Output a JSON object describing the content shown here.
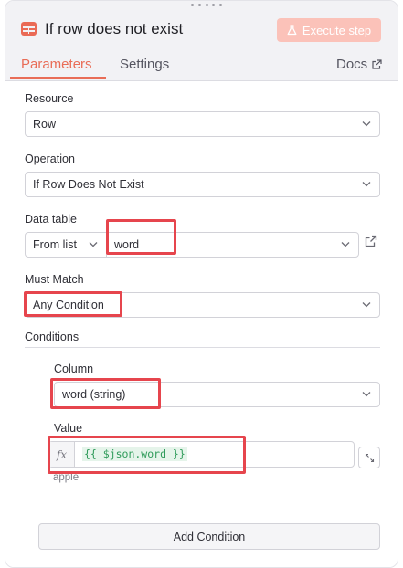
{
  "header": {
    "node_icon": "table-icon",
    "title": "If row does not exist",
    "execute_label": "Execute step",
    "execute_icon": "flask-icon",
    "accent_color": "#e96d57"
  },
  "tabs": {
    "parameters": "Parameters",
    "settings": "Settings",
    "docs": "Docs",
    "docs_icon": "external-link-icon"
  },
  "form": {
    "resource": {
      "label": "Resource",
      "value": "Row"
    },
    "operation": {
      "label": "Operation",
      "value": "If Row Does Not Exist"
    },
    "data_table": {
      "label": "Data table",
      "mode": "From list",
      "value": "word"
    },
    "must_match": {
      "label": "Must Match",
      "value": "Any Condition"
    },
    "conditions": {
      "title": "Conditions",
      "column_label": "Column",
      "column_value": "word (string)",
      "value_label": "Value",
      "fx": "fx",
      "expression": "{{ $json.word }}",
      "expression_result": "apple"
    },
    "add_condition": "Add Condition"
  },
  "annotation_color": "#e6454d"
}
